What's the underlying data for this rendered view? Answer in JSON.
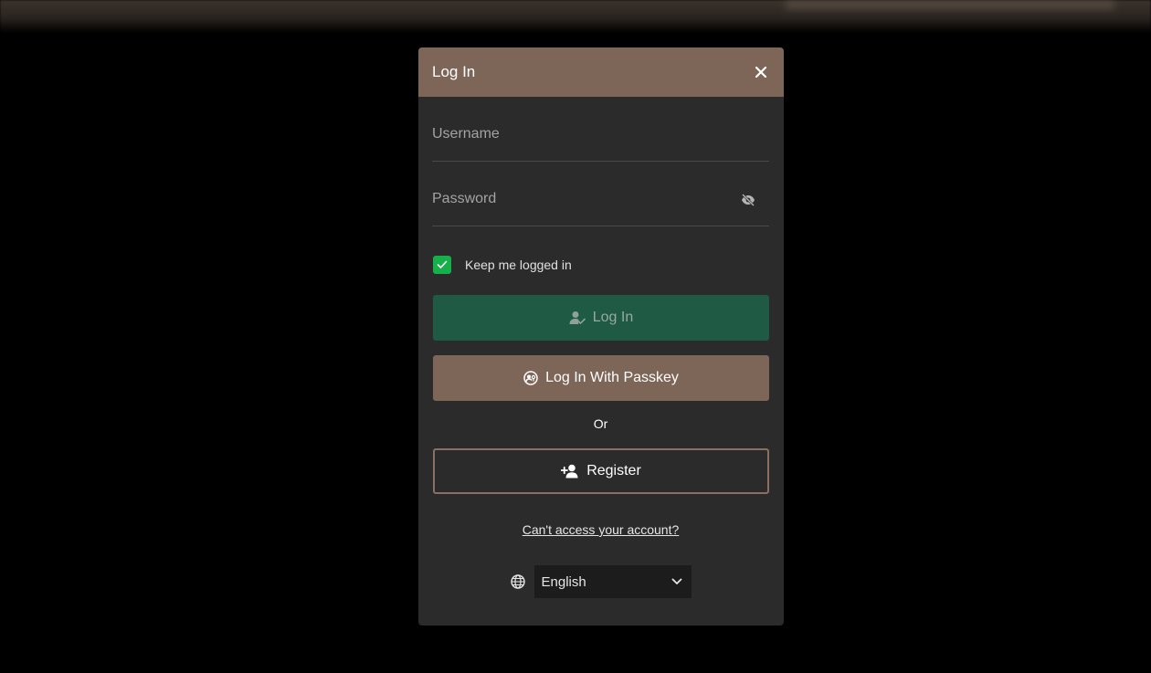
{
  "modal": {
    "title": "Log In",
    "close_icon": "close-icon"
  },
  "form": {
    "username_placeholder": "Username",
    "password_placeholder": "Password",
    "toggle_password_icon": "eye-off-icon",
    "keep_logged_in_label": "Keep me logged in",
    "keep_logged_in_checked": true
  },
  "buttons": {
    "login_label": "Log In",
    "login_icon": "user-check-icon",
    "passkey_label": "Log In With Passkey",
    "passkey_icon": "passkey-icon",
    "or_text": "Or",
    "register_label": "Register",
    "register_icon": "user-plus-icon"
  },
  "links": {
    "forgot_account": "Can't access your account?"
  },
  "language": {
    "icon": "globe-icon",
    "selected": "English",
    "chevron_icon": "chevron-down-icon"
  },
  "colors": {
    "header": "#7d6558",
    "login_button": "#1e5a44",
    "checkbox": "#16b04a",
    "passkey_button": "#7d6558",
    "register_border": "#8a7061"
  }
}
